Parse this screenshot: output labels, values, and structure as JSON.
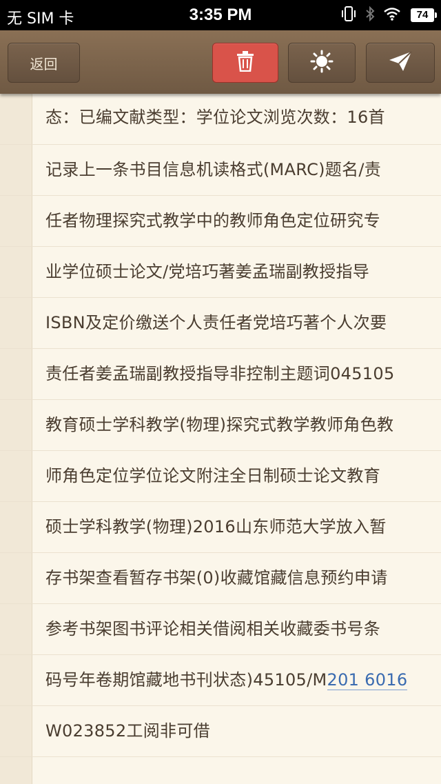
{
  "status_bar": {
    "carrier": "无 SIM 卡",
    "time": "3:35 PM",
    "battery": "74"
  },
  "toolbar": {
    "back_label": "返回",
    "delete_icon": "trash-icon",
    "brightness_icon": "sun-icon",
    "send_icon": "paper-plane-icon",
    "delete_color": "#d9534a"
  },
  "content": {
    "lines": [
      "态：已编文献类型：学位论文浏览次数：16首",
      "记录上一条书目信息机读格式(MARC)题名/责",
      "任者物理探究式教学中的教师角色定位研究专",
      "业学位硕士论文/党培巧著姜孟瑞副教授指导",
      "ISBN及定价缴送个人责任者党培巧著个人次要",
      "责任者姜孟瑞副教授指导非控制主题词045105",
      "教育硕士学科教学(物理)探究式教学教师角色教",
      "师角色定位学位论文附注全日制硕士论文教育",
      "硕士学科教学(物理)2016山东师范大学放入暂",
      "存书架查看暂存书架(0)收藏馆藏信息预约申请",
      "参考书架图书评论相关借阅相关收藏委书号条"
    ],
    "line12_prefix": "码号年卷期馆藏地书刊状态)45105/M",
    "line12_link": "201 6016",
    "line13": "W023852工阅非可借"
  }
}
